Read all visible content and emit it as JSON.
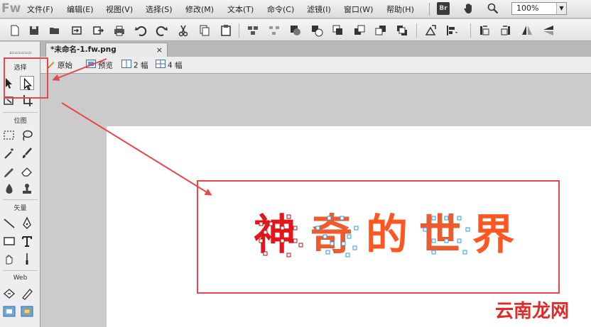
{
  "app": {
    "logo": "Fw",
    "bridge_badge": "Br",
    "menu": [
      "文件(F)",
      "编辑(E)",
      "视图(V)",
      "选择(S)",
      "修改(M)",
      "文本(T)",
      "命令(C)",
      "滤镜(I)",
      "窗口(W)",
      "帮助(H)"
    ],
    "zoom": "100%"
  },
  "toolbar_icons": [
    "new-icon",
    "save-icon",
    "open-icon",
    "import-icon",
    "export-icon",
    "print-icon",
    "undo-icon",
    "redo-icon",
    "cut-icon",
    "copy-icon",
    "paste-icon",
    "group-icon",
    "ungroup-icon",
    "join-icon",
    "split-icon",
    "bring-front-icon",
    "bring-forward-icon",
    "send-backward-icon",
    "send-back-icon",
    "rotate-icon",
    "align-icon",
    "rotate-ccw-icon",
    "rotate-cw-icon",
    "flip-horizontal-icon",
    "flip-vertical-icon"
  ],
  "tools": {
    "sections": {
      "select": "选择",
      "bitmap": "位图",
      "vector": "矢量",
      "web": "Web"
    }
  },
  "document": {
    "tab_title": "*未命名-1.fw.png",
    "close": "×",
    "views": [
      "原始",
      "预览",
      "2 幅",
      "4 幅"
    ]
  },
  "canvas": {
    "chars": [
      "神",
      "奇",
      "的",
      "世",
      "界"
    ],
    "colors": {
      "shen": "#e3161c",
      "qi": "#f15b2c",
      "de": "#ff5622",
      "shi": "#f15b2c",
      "jie": "#ff5622",
      "annotation": "#e8474d",
      "path_points": "#2b9bd8"
    }
  },
  "watermark": "云南龙网"
}
